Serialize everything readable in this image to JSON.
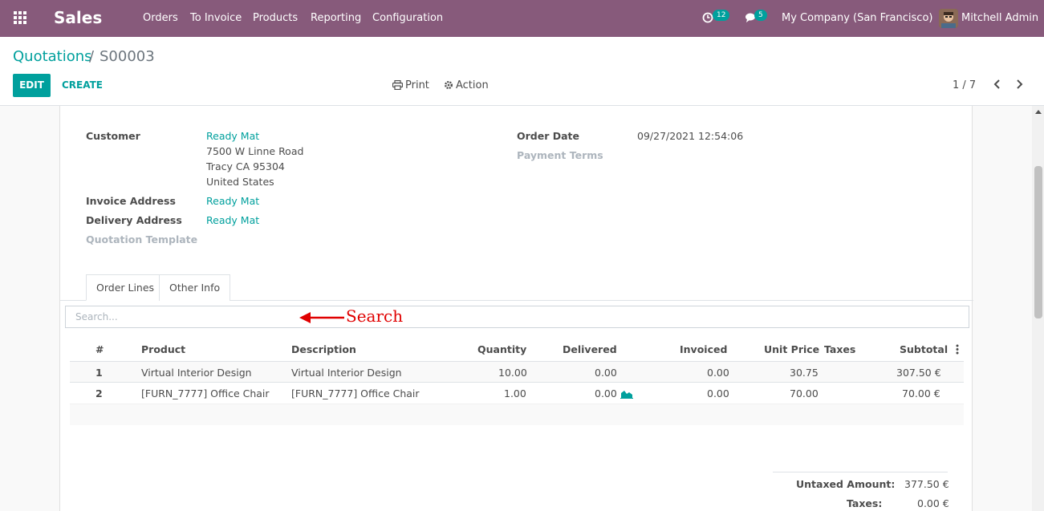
{
  "navbar": {
    "app_name": "Sales",
    "menu": [
      "Orders",
      "To Invoice",
      "Products",
      "Reporting",
      "Configuration"
    ],
    "activity_count": "12",
    "message_count": "5",
    "company": "My Company (San Francisco)",
    "user": "Mitchell Admin"
  },
  "breadcrumb": {
    "parent": "Quotations",
    "separator": "/",
    "current": "S00003"
  },
  "buttons": {
    "edit": "EDIT",
    "create": "CREATE",
    "print": "Print",
    "action": "Action"
  },
  "pager": {
    "value": "1 / 7"
  },
  "form": {
    "customer_label": "Customer",
    "customer_name": "Ready Mat",
    "address_line1": "7500 W Linne Road",
    "address_line2": "Tracy CA 95304",
    "address_line3": "United States",
    "invoice_address_label": "Invoice Address",
    "invoice_address": "Ready Mat",
    "delivery_address_label": "Delivery Address",
    "delivery_address": "Ready Mat",
    "quotation_template_label": "Quotation Template",
    "order_date_label": "Order Date",
    "order_date": "09/27/2021 12:54:06",
    "payment_terms_label": "Payment Terms"
  },
  "tabs": [
    "Order Lines",
    "Other Info"
  ],
  "search": {
    "placeholder": "Search...",
    "annotation": "Search"
  },
  "table": {
    "headers": [
      "#",
      "Product",
      "Description",
      "Quantity",
      "Delivered",
      "Invoiced",
      "Unit Price",
      "Taxes",
      "Subtotal"
    ],
    "rows": [
      [
        "1",
        "Virtual Interior Design",
        "Virtual Interior Design",
        "10.00",
        "0.00",
        "0.00",
        "30.75",
        "",
        "307.50 €"
      ],
      [
        "2",
        "[FURN_7777] Office Chair",
        "[FURN_7777] Office Chair",
        "1.00",
        "0.00",
        "0.00",
        "70.00",
        "",
        "70.00 €"
      ]
    ]
  },
  "totals": {
    "untaxed_label": "Untaxed Amount:",
    "untaxed_value": "377.50 €",
    "taxes_label": "Taxes:",
    "taxes_value": "0.00 €"
  },
  "icons": {
    "apps": "apps-grid-icon",
    "activity": "clock-icon",
    "messages": "chat-bubble-icon",
    "print": "printer-icon",
    "action": "gear-icon",
    "forecast": "area-chart-icon",
    "options": "kebab-icon"
  },
  "colors": {
    "navbar": "#875a7b",
    "accent": "#00a09d",
    "annotation": "#e00000"
  }
}
